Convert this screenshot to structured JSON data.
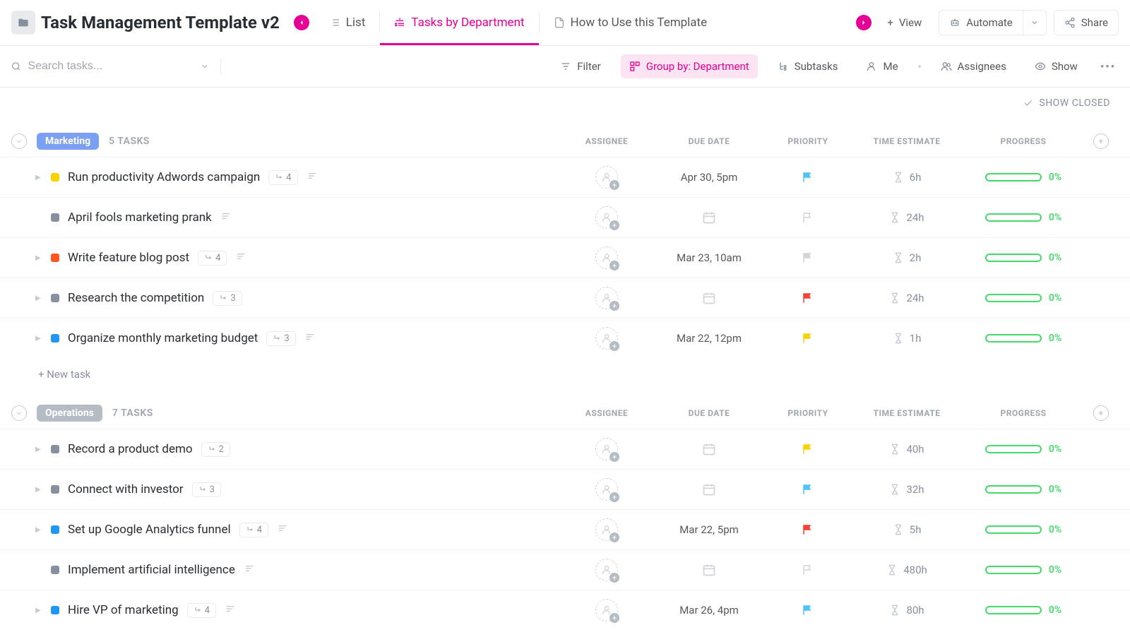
{
  "header": {
    "title": "Task Management Template v2",
    "tabs": [
      {
        "label": "List",
        "icon": "list-icon"
      },
      {
        "label": "Tasks by Department",
        "icon": "pinned-list-icon"
      },
      {
        "label": "How to Use this Template",
        "icon": "doc-icon"
      }
    ],
    "view_btn": "View",
    "automate_btn": "Automate",
    "share_btn": "Share"
  },
  "toolbar": {
    "search_placeholder": "Search tasks...",
    "filter": "Filter",
    "group_by": "Group by: Department",
    "subtasks": "Subtasks",
    "me": "Me",
    "assignees": "Assignees",
    "show": "Show"
  },
  "show_closed": "SHOW CLOSED",
  "columns": {
    "assignee": "ASSIGNEE",
    "due_date": "DUE DATE",
    "priority": "PRIORITY",
    "time_estimate": "TIME ESTIMATE",
    "progress": "PROGRESS"
  },
  "groups": [
    {
      "name": "Marketing",
      "badge_class": "marketing",
      "task_count": "5 TASKS",
      "tasks": [
        {
          "expand": true,
          "status_color": "#f9d000",
          "name": "Run productivity Adwords campaign",
          "subtasks": "4",
          "has_desc": true,
          "due": "Apr 30, 5pm",
          "priority_color": "#4fc3f7",
          "time": "6h",
          "progress": "0%"
        },
        {
          "expand": false,
          "status_color": "#87909e",
          "name": "April fools marketing prank",
          "subtasks": null,
          "has_desc": true,
          "due": null,
          "priority_color": "#d0d4da",
          "priority_outline": true,
          "time": "24h",
          "progress": "0%"
        },
        {
          "expand": true,
          "status_color": "#ff5722",
          "name": "Write feature blog post",
          "subtasks": "4",
          "has_desc": true,
          "due": "Mar 23, 10am",
          "priority_color": "#d0d4da",
          "time": "2h",
          "progress": "0%"
        },
        {
          "expand": true,
          "status_color": "#87909e",
          "name": "Research the competition",
          "subtasks": "3",
          "has_desc": false,
          "due": null,
          "priority_color": "#f44336",
          "time": "24h",
          "progress": "0%"
        },
        {
          "expand": true,
          "status_color": "#2196f3",
          "name": "Organize monthly marketing budget",
          "subtasks": "3",
          "has_desc": true,
          "due": "Mar 22, 12pm",
          "priority_color": "#f9d000",
          "time": "1h",
          "progress": "0%"
        }
      ],
      "new_task": "+ New task"
    },
    {
      "name": "Operations",
      "badge_class": "operations",
      "task_count": "7 TASKS",
      "tasks": [
        {
          "expand": true,
          "status_color": "#87909e",
          "name": "Record a product demo",
          "subtasks": "2",
          "has_desc": false,
          "due": null,
          "priority_color": "#f9d000",
          "time": "40h",
          "progress": "0%"
        },
        {
          "expand": true,
          "status_color": "#87909e",
          "name": "Connect with investor",
          "subtasks": "3",
          "has_desc": false,
          "due": null,
          "priority_color": "#4fc3f7",
          "time": "32h",
          "progress": "0%"
        },
        {
          "expand": true,
          "status_color": "#2196f3",
          "name": "Set up Google Analytics funnel",
          "subtasks": "4",
          "has_desc": true,
          "due": "Mar 22, 5pm",
          "priority_color": "#f44336",
          "time": "5h",
          "progress": "0%"
        },
        {
          "expand": false,
          "status_color": "#87909e",
          "name": "Implement artificial intelligence",
          "subtasks": null,
          "has_desc": true,
          "due": null,
          "priority_color": "#d0d4da",
          "priority_outline": true,
          "time": "480h",
          "progress": "0%"
        },
        {
          "expand": true,
          "status_color": "#2196f3",
          "name": "Hire VP of marketing",
          "subtasks": "4",
          "has_desc": true,
          "due": "Mar 26, 4pm",
          "priority_color": "#4fc3f7",
          "time": "80h",
          "progress": "0%"
        }
      ]
    }
  ]
}
